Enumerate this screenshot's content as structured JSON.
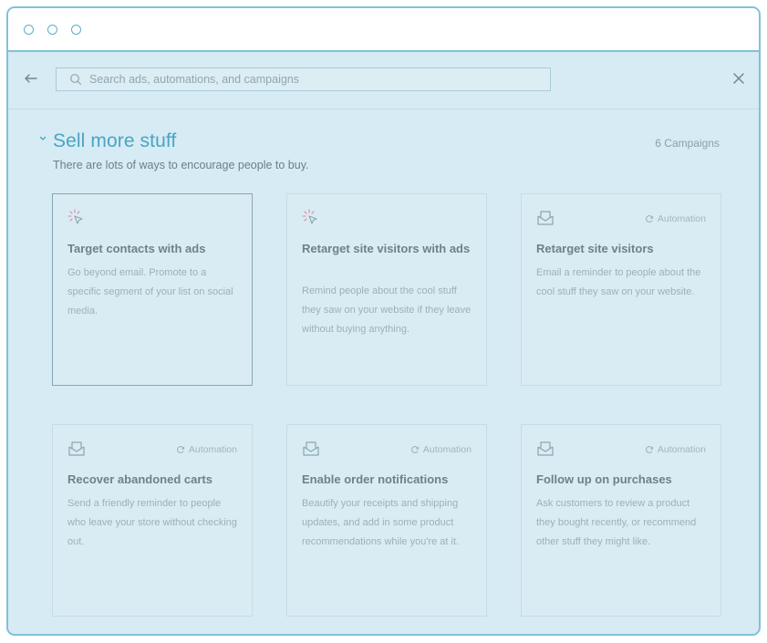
{
  "window": {
    "controls": [
      "close",
      "minimize",
      "maximize"
    ]
  },
  "toolbar": {
    "back_icon": "arrow-left-icon",
    "search_placeholder": "Search ads, automations, and campaigns",
    "close_icon": "close-icon"
  },
  "section": {
    "title": "Sell more stuff",
    "subtitle": "There are lots of ways to encourage people to buy.",
    "count": "6 Campaigns"
  },
  "cards": [
    {
      "icon": "cursor-click-icon",
      "badge": "",
      "title": "Target contacts with ads",
      "description": "Go beyond email. Promote to a specific segment of your list on social media.",
      "selected": true
    },
    {
      "icon": "cursor-click-icon",
      "badge": "",
      "title": "Retarget site visitors with ads",
      "description": "Remind people about the cool stuff they saw on your website if they leave without buying anything.",
      "selected": false
    },
    {
      "icon": "email-icon",
      "badge": "Automation",
      "title": "Retarget site visitors",
      "description": "Email a reminder to people about the cool stuff they saw on your website.",
      "selected": false
    },
    {
      "icon": "email-icon",
      "badge": "Automation",
      "title": "Recover abandoned carts",
      "description": "Send a friendly reminder to people who leave your store without checking out.",
      "selected": false
    },
    {
      "icon": "email-icon",
      "badge": "Automation",
      "title": "Enable order notifications",
      "description": "Beautify your receipts and shipping updates, and add in some product recommendations while you're at it.",
      "selected": false
    },
    {
      "icon": "email-icon",
      "badge": "Automation",
      "title": "Follow up on purchases",
      "description": "Ask customers to review a product they bought recently, or recommend other stuff they might like.",
      "selected": false
    }
  ],
  "colors": {
    "accent": "#4ba4c5",
    "frame": "#7ec3d8",
    "overlay": "#d6ebf3",
    "click_icon": "#e3849c"
  }
}
